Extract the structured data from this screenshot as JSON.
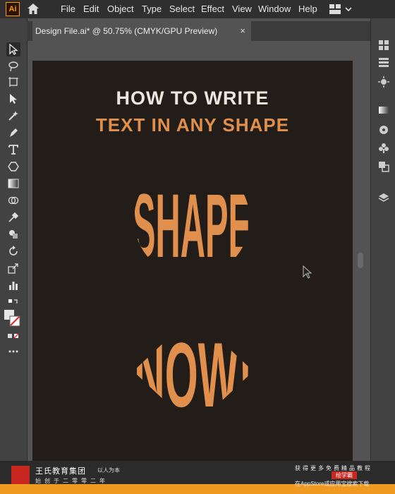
{
  "app": {
    "logo": "Ai"
  },
  "menu": [
    "File",
    "Edit",
    "Object",
    "Type",
    "Select",
    "Effect",
    "View",
    "Window",
    "Help"
  ],
  "document": {
    "tab_title": "Design File.ai* @ 50.75% (CMYK/GPU Preview)",
    "close": "×"
  },
  "artwork": {
    "line1": "HOW TO WRITE",
    "line2": "TEXT IN ANY SHAPE",
    "word_circle": "SHAPE",
    "word_diamond": "NOW!",
    "colors": {
      "background": "#221d19",
      "accent": "#e0904c",
      "white": "#ede6dc"
    }
  },
  "watermark": {
    "brand": "王氏教育集团",
    "tagline": "以人为本",
    "sub": "始创于二零零二年",
    "promo1": "获得更多免费精品教程",
    "promo2": "绘学霸",
    "promo3": "在AppStore或应用宝搜索下载"
  },
  "icons": [
    "home-icon",
    "workspace-icon",
    "selection-tool-icon",
    "direct-selection-icon",
    "magic-wand-icon",
    "pen-tool-icon",
    "type-tool-icon",
    "ellipse-tool-icon",
    "gradient-icon",
    "eyedropper-icon",
    "rotate-icon",
    "scale-icon",
    "graph-icon",
    "color-swatch-icon",
    "layers-icon"
  ]
}
